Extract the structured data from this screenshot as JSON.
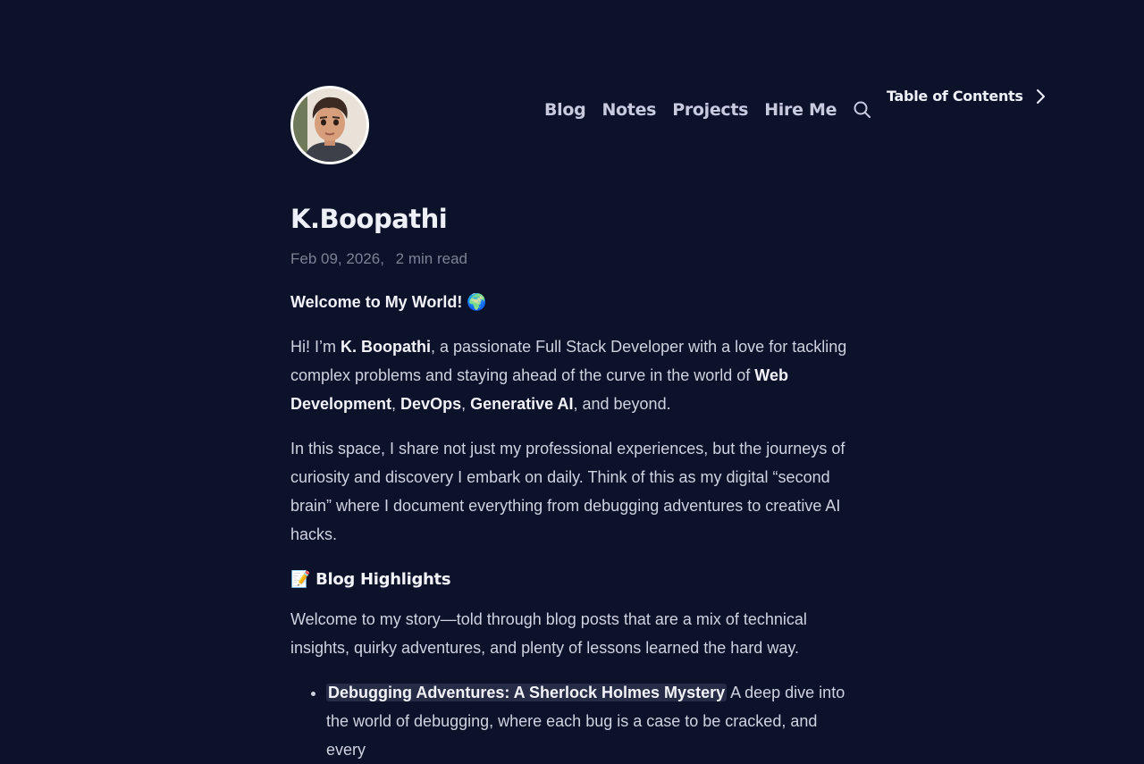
{
  "nav": {
    "items": [
      "Blog",
      "Notes",
      "Projects",
      "Hire Me"
    ]
  },
  "toc": {
    "label": "Table of Contents"
  },
  "post": {
    "title": "K.Boopathi",
    "date": "Feb 09, 2026,",
    "read_time": "2 min read",
    "welcome": "Welcome to My World! 🌍",
    "intro": {
      "t1": "Hi! I’m ",
      "name": "K. Boopathi",
      "t2": ", a passionate Full Stack Developer with a love for tackling complex problems and staying ahead of the curve in the world of ",
      "s1": "Web Development",
      "c1": ", ",
      "s2": "DevOps",
      "c2": ", ",
      "s3": "Generative AI",
      "t3": ", and beyond."
    },
    "para2": "In this space, I share not just my professional experiences, but the journeys of curiosity and discovery I embark on daily. Think of this as my digital “second brain” where I document everything from debugging adventures to creative AI hacks.",
    "section_heading": "📝 Blog Highlights",
    "para3": "Welcome to my story—told through blog posts that are a mix of technical insights, quirky adventures, and plenty of lessons learned the hard way.",
    "highlights": [
      {
        "link": "Debugging Adventures: A Sherlock Holmes Mystery",
        "desc": " A deep dive into the world of debugging, where each bug is a case to be cracked, and every"
      }
    ]
  },
  "colors": {
    "background": "#0d122b",
    "highlight_bg": "#262c45"
  },
  "icons": [
    "avatar-image",
    "search-icon",
    "chevron-right-icon"
  ]
}
